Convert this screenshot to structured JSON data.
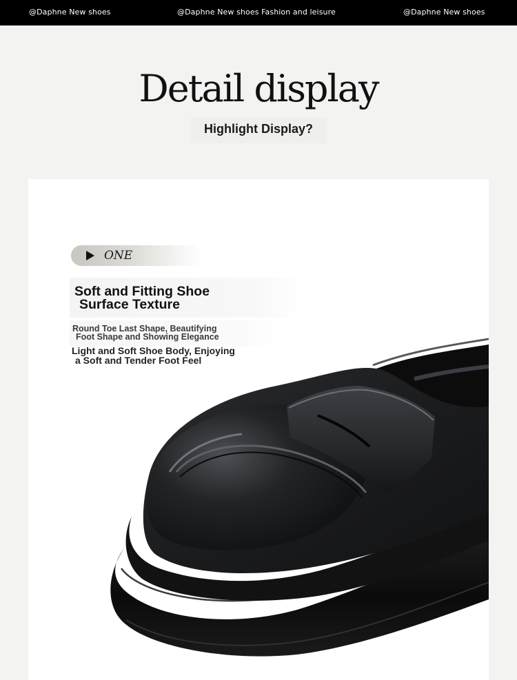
{
  "top_bar": {
    "left": "@Daphne New shoes",
    "center": "@Daphne New shoes Fashion and leisure",
    "right": "@Daphne New shoes"
  },
  "header": {
    "title": "Detail display",
    "subtitle": "Highlight Display?"
  },
  "feature": {
    "badge_label": "ONE",
    "title_line1": "Soft and Fitting Shoe",
    "title_line2": "Surface Texture",
    "desc1_line1": "Round Toe Last Shape, Beautifying",
    "desc1_line2": "Foot Shape and Showing Elegance",
    "desc2_line1": "Light and Soft Shoe Body, Enjoying",
    "desc2_line2": "a Soft and Tender Foot Feel"
  },
  "product_image": {
    "icon": "black-loafer-shoe",
    "colors": {
      "leather": "#1b1c1e",
      "sole": "#0f0f10",
      "highlight": "#6c6f73"
    }
  }
}
